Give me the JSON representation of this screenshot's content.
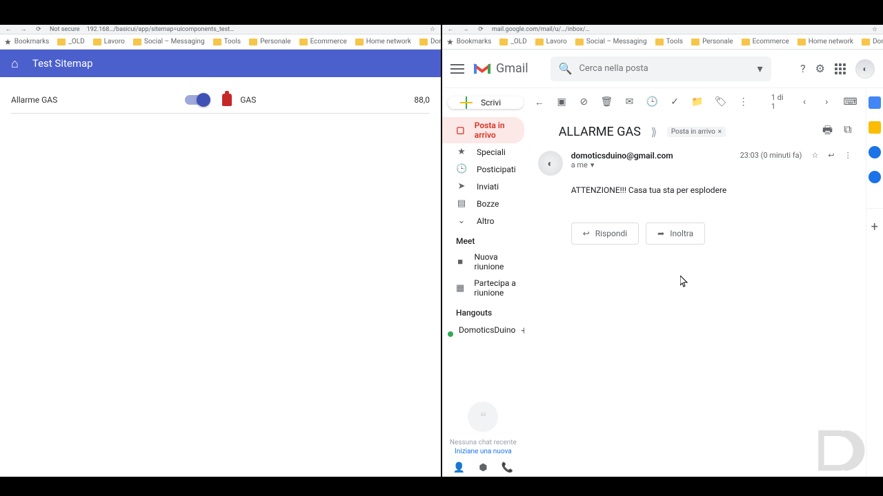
{
  "bookmarks": {
    "star": "Bookmarks",
    "items": [
      "_OLD",
      "Lavoro",
      "Social – Messaging",
      "Tools",
      "Personale",
      "Ecommerce",
      "Home network",
      "Domoticsduino"
    ]
  },
  "left": {
    "url_hint": "192.168…/basicui/app/sitemap=uicomponents_test…",
    "not_secure": "Not secure",
    "title": "Test Sitemap",
    "rows": {
      "alarm_label": "Allarme GAS",
      "gas_label": "GAS",
      "gas_value": "88,0"
    }
  },
  "right": {
    "url_hint": "mail.google.com/mail/u/…/inbox/…",
    "brand": "Gmail",
    "search_placeholder": "Cerca nella posta",
    "compose": "Scrivi",
    "sidebar": {
      "inbox": "Posta in arrivo",
      "starred": "Speciali",
      "snoozed": "Posticipati",
      "sent": "Inviati",
      "drafts": "Bozze",
      "more": "Altro",
      "meet": "Meet",
      "new_meeting": "Nuova riunione",
      "join_meeting": "Partecipa a riunione",
      "hangouts": "Hangouts",
      "hangout_user": "DomoticsDuino",
      "no_chat_line1": "Nessuna chat recente",
      "no_chat_line2": "Iniziane una nuova"
    },
    "toolbar": {
      "count": "1 di 1"
    },
    "message": {
      "subject": "ALLARME GAS",
      "label_chip": "Posta in arrivo",
      "from": "domoticsduino@gmail.com",
      "to": "a me",
      "time": "23:03 (0 minuti fa)",
      "body": "ATTENZIONE!!! Casa tua sta per esplodere",
      "reply": "Rispondi",
      "forward": "Inoltra"
    }
  }
}
